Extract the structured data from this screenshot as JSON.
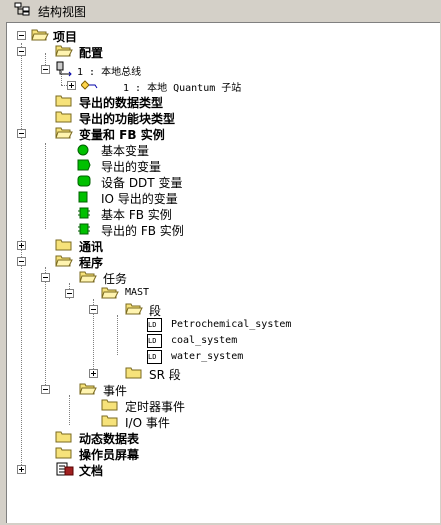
{
  "window": {
    "title": "结构视图"
  },
  "tree": {
    "project": "项目",
    "config": "配置",
    "local_bus": "1 : 本地总线",
    "quantum_station": "1 : 本地 Quantum 子站",
    "exported_data_types": "导出的数据类型",
    "exported_fb_types": "导出的功能块类型",
    "vars_fb": "变量和 FB 实例",
    "var_items": [
      "基本变量",
      "导出的变量",
      "设备 DDT 变量",
      "IO 导出的变量",
      "基本 FB 实例",
      "导出的 FB 实例"
    ],
    "comm": "通讯",
    "program": "程序",
    "tasks": "任务",
    "mast": "MAST",
    "sections": "段",
    "section_items": [
      "Petrochemical_system",
      "coal_system",
      "water_system"
    ],
    "ld_tag": "LD",
    "sr": "SR 段",
    "events": "事件",
    "timer_events": "定时器事件",
    "io_events": "I/O 事件",
    "animation_tables": "动态数据表",
    "operator_screens": "操作员屏幕",
    "documentation": "文档"
  }
}
